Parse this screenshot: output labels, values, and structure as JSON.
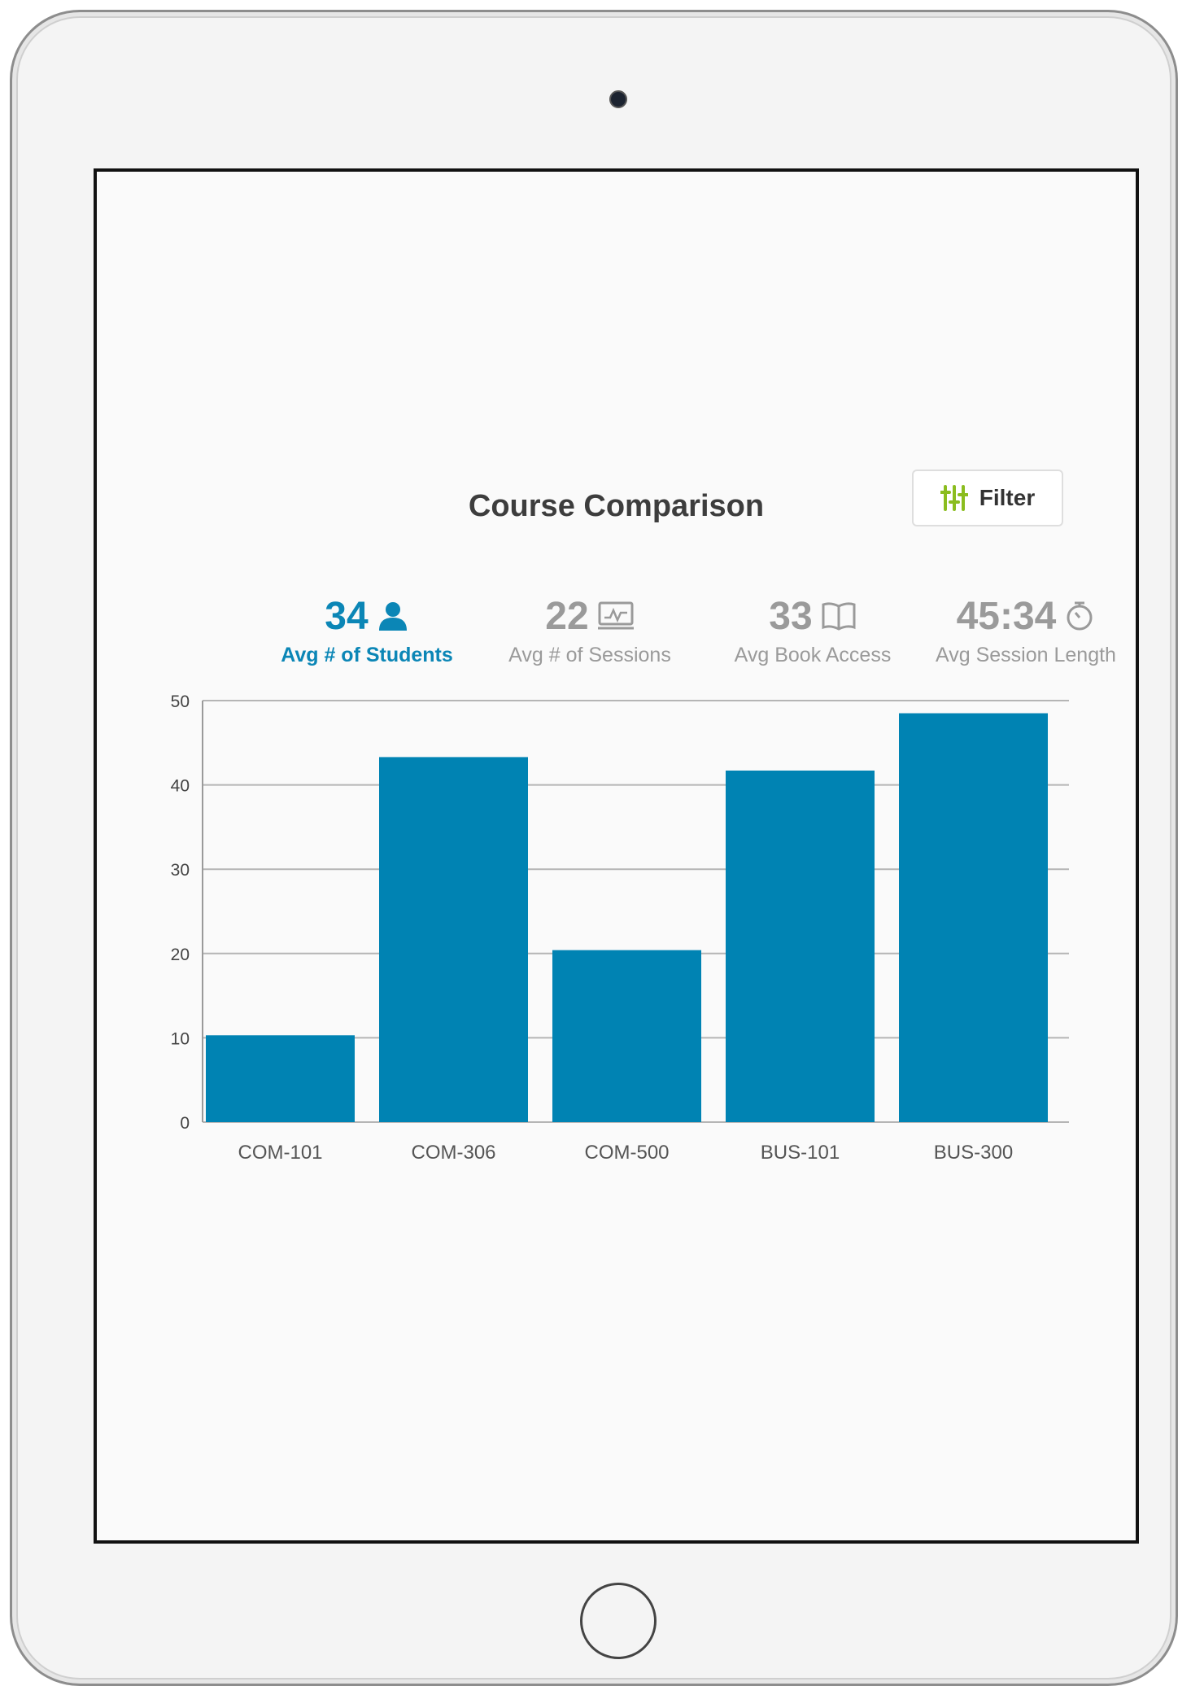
{
  "title": "Course Comparison",
  "filter": {
    "label": "Filter",
    "icon": "sliders-icon",
    "icon_color": "#8bbd1f"
  },
  "stats": [
    {
      "value": "34",
      "label": "Avg # of Students",
      "icon": "person-icon",
      "active": true
    },
    {
      "value": "22",
      "label": "Avg # of Sessions",
      "icon": "monitor-chart-icon",
      "active": false
    },
    {
      "value": "33",
      "label": "Avg Book Access",
      "icon": "book-icon",
      "active": false
    },
    {
      "value": "45:34",
      "label": "Avg Session Length",
      "icon": "stopwatch-icon",
      "active": false
    }
  ],
  "colors": {
    "accent": "#0b86b6",
    "bar": "#0083b3",
    "muted": "#9a9a9a"
  },
  "chart_data": {
    "type": "bar",
    "categories": [
      "COM-101",
      "COM-306",
      "COM-500",
      "BUS-101",
      "BUS-300"
    ],
    "values": [
      10.3,
      43.3,
      20.4,
      41.7,
      48.5
    ],
    "yticks": [
      0,
      10,
      20,
      30,
      40,
      50
    ],
    "ylim": [
      0,
      50
    ],
    "grid": true
  }
}
